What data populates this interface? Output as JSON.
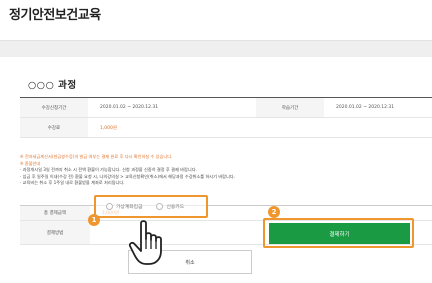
{
  "page": {
    "title": "정기안전보건교육"
  },
  "section": {
    "title": "○○○ 과정"
  },
  "info": {
    "row1": {
      "label1": "수강신청기간",
      "value1": "2020.01.02 ~ 2020.12.31",
      "label2": "학습기간",
      "value2": "2020.01.02 ~ 2020.12.31"
    },
    "row2": {
      "label": "수강료",
      "value": "1,000원"
    }
  },
  "notes": {
    "warning": "※ 전자세금계산서(현금영수증)의 발급 여부는 결제 완료 후 다시 확인하실 수 있습니다.",
    "heading": "※ 환불안내",
    "lines": [
      "· 과정개시일 3일 전까지 취소 시 전액 환불이 가능합니다. 신청 과정을 신중히 결정 후 결제 바랍니다.",
      "· 입금 후 일주일 이내(수강 전) 환불 요청 시, 나의강의실 > 교육신청확인(취소)에서 해당과정 수강취소를 하시기 바랍니다.",
      "· 교육비는 취소 후 1주일 내로 환불받을 계좌로 처리됩니다."
    ]
  },
  "payment": {
    "amount_label": "총 결제금액",
    "amount_value": "1,000원",
    "method_label": "결제방법",
    "options": [
      "가상계좌입금",
      "신용카드"
    ]
  },
  "buttons": {
    "cancel": "취소",
    "pay": "결제하기"
  },
  "badges": {
    "one": "1",
    "two": "2"
  },
  "colors": {
    "accent_orange": "#f0962e",
    "pay_green": "#1b9a44",
    "price_orange": "#e0752d"
  }
}
